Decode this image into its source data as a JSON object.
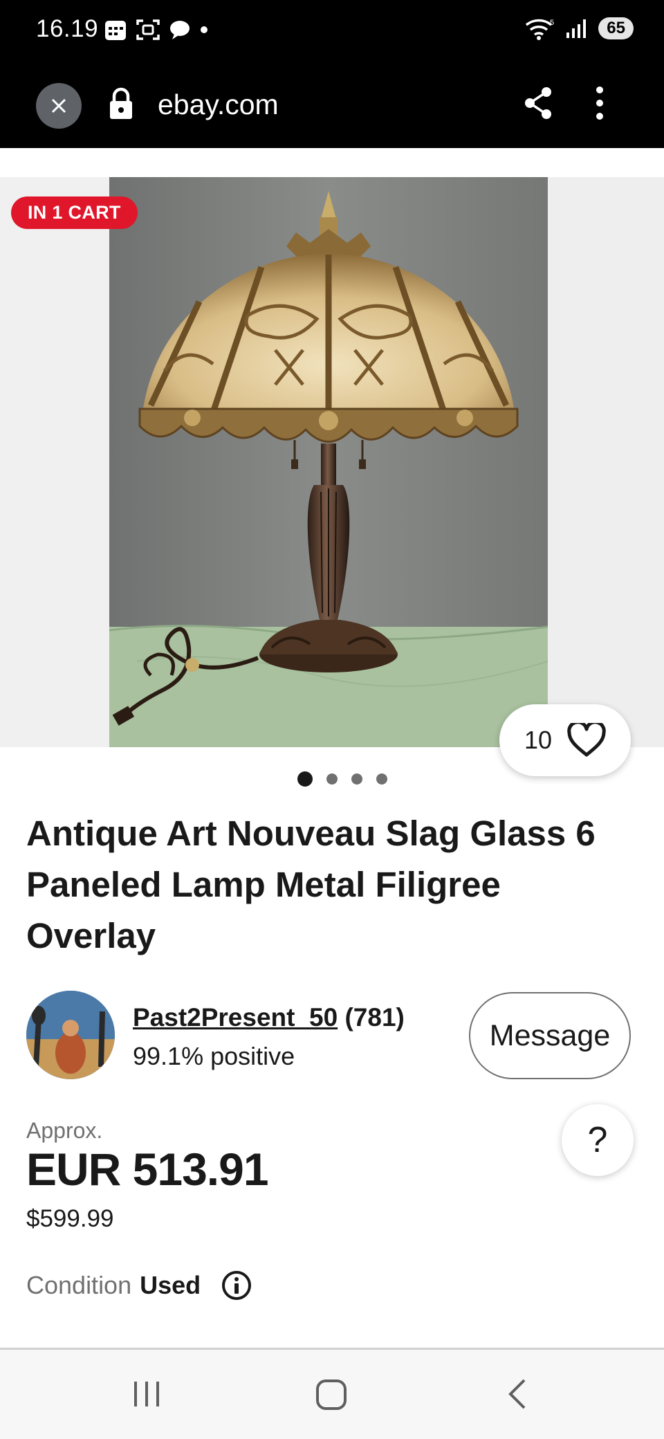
{
  "status_bar": {
    "time": "16.19",
    "battery": "65"
  },
  "browser": {
    "url": "ebay.com"
  },
  "gallery": {
    "cart_badge": "IN 1 CART",
    "watch_count": "10",
    "image_count": 4,
    "active_index": 0
  },
  "listing": {
    "title": "Antique Art Nouveau Slag Glass 6 Paneled Lamp Metal Filigree Overlay"
  },
  "seller": {
    "name": "Past2Present_50",
    "rating_count": "(781)",
    "feedback": "99.1% positive",
    "message_label": "Message"
  },
  "price": {
    "approx_label": "Approx.",
    "converted": "EUR 513.91",
    "original": "$599.99",
    "help_label": "?"
  },
  "condition": {
    "label": "Condition",
    "value": "Used"
  },
  "colors": {
    "badge_red": "#e0162b",
    "text": "#191919",
    "muted": "#707070"
  }
}
